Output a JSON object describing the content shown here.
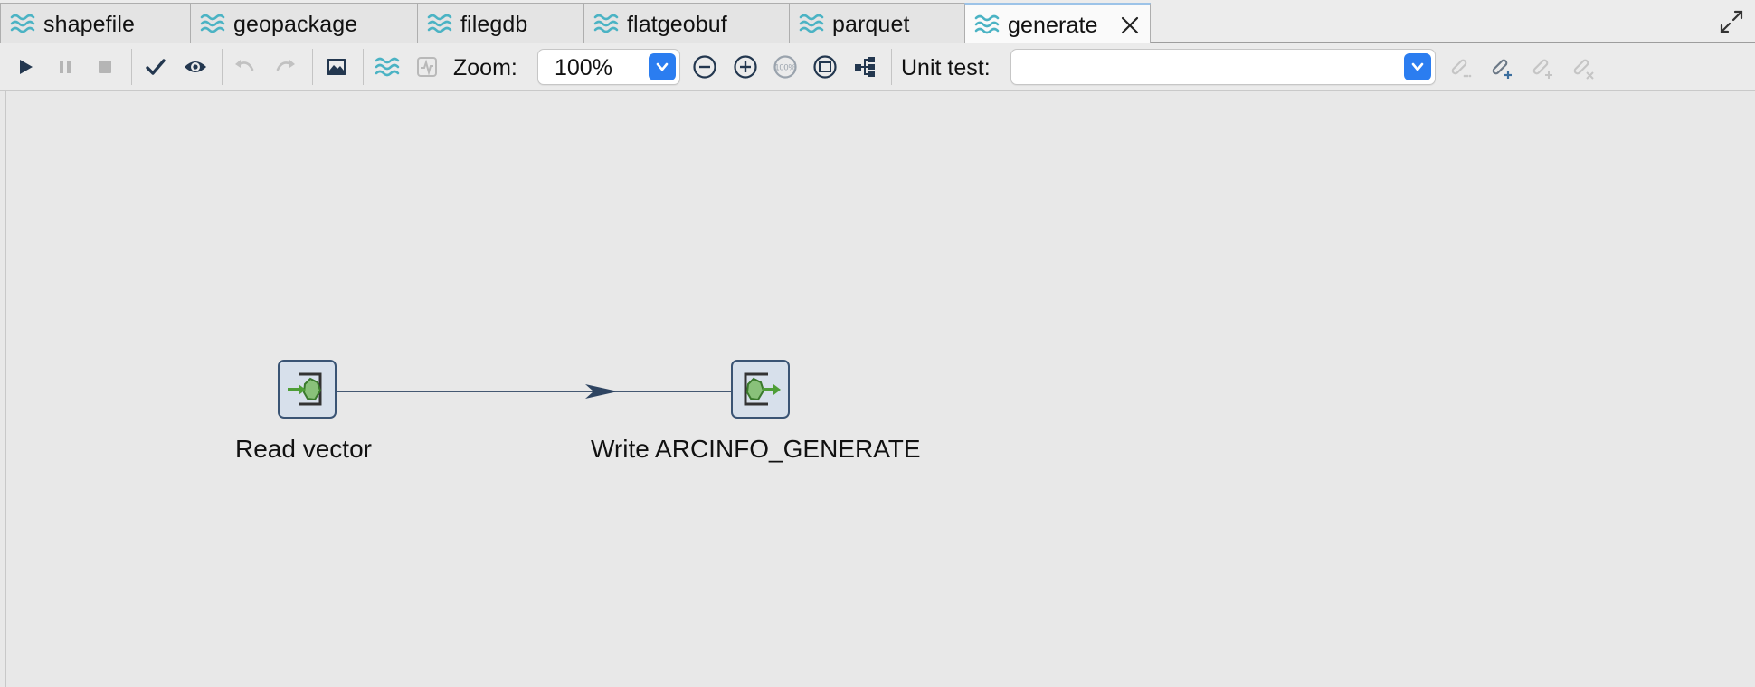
{
  "tabs": [
    {
      "label": "shapefile",
      "active": false
    },
    {
      "label": "geopackage",
      "active": false
    },
    {
      "label": "filegdb",
      "active": false
    },
    {
      "label": "flatgeobuf",
      "active": false
    },
    {
      "label": "parquet",
      "active": false
    },
    {
      "label": "generate",
      "active": true
    }
  ],
  "toolbar": {
    "zoom_label": "Zoom:",
    "zoom_value": "100%",
    "zoom_100_text": "100%",
    "unit_test_label": "Unit test:",
    "unit_test_value": ""
  },
  "icons": {
    "tab": "waves-icon",
    "tab_close": "close-icon",
    "maximize": "maximize-icon",
    "run": "play-icon",
    "pause": "pause-icon",
    "stop": "stop-icon",
    "verify": "checkmark-icon",
    "preview": "eye-icon",
    "undo": "undo-icon",
    "redo": "redo-icon",
    "screenshot": "image-icon",
    "pipeline": "waves-icon",
    "metrics": "pipeline-metrics-icon",
    "zoom_out": "zoom-out-icon",
    "zoom_in": "zoom-in-icon",
    "zoom_100": "zoom-100-icon",
    "zoom_fit": "zoom-fit-icon",
    "layout": "hierarchy-icon",
    "test_edit": "test-edit-icon",
    "test_new": "test-new-icon",
    "test_add": "test-add-icon",
    "test_delete": "test-delete-icon"
  },
  "canvas": {
    "transforms": [
      {
        "id": "read",
        "label": "Read vector",
        "kind": "input"
      },
      {
        "id": "write",
        "label": "Write ARCINFO_GENERATE",
        "kind": "output"
      }
    ],
    "hops": [
      {
        "from": "read",
        "to": "write"
      }
    ]
  },
  "colors": {
    "accent_blue": "#2b7df0",
    "tab_icon_teal": "#4bb3c4",
    "node_border": "#3a5474",
    "node_fill": "#d7e0eb",
    "node_green": "#58a23f",
    "hop_line": "#2e4461",
    "canvas_bg": "#e8e8e8"
  }
}
